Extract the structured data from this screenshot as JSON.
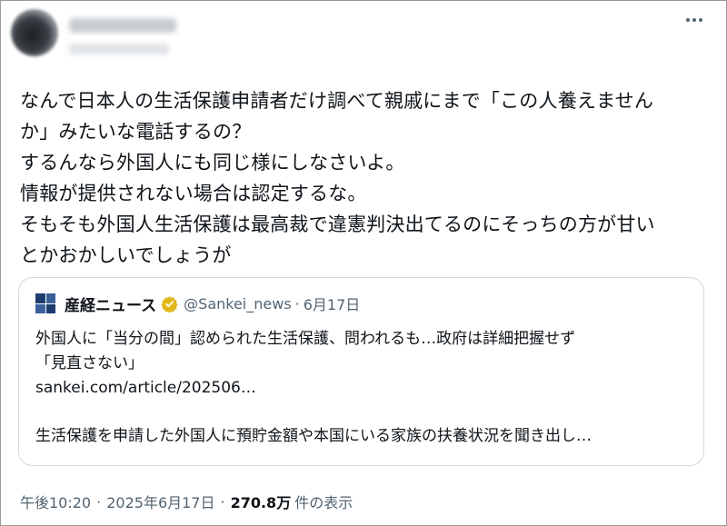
{
  "post": {
    "text_lines": [
      "なんで日本人の生活保護申請者だけ調べて親戚にまで「この人養えません",
      "か」みたいな電話するの？",
      "するんなら外国人にも同じ様にしなさいよ。",
      "情報が提供されない場合は認定するな。",
      "そもそも外国人生活保護は最高裁で違憲判決出てるのにそっちの方が甘い",
      "とかおかしいでしょうが"
    ]
  },
  "quote": {
    "name": "産経ニュース",
    "handle": "@Sankei_news",
    "dot": "·",
    "date": "6月17日",
    "lines": [
      "外国人に「当分の間」認められた生活保護、問われるも…政府は詳細把握せず",
      "「見直さない」",
      "sankei.com/article/202506…"
    ],
    "summary": "生活保護を申請した外国人に預貯金額や本国にいる家族の扶養状況を聞き出し…"
  },
  "meta": {
    "time": "午後10:20",
    "sep": "·",
    "date": "2025年6月17日",
    "views": "270.8万",
    "views_label": "件の表示"
  },
  "colors": {
    "text": "#0f1419",
    "secondary": "#536471",
    "border": "#cfd9de",
    "verified_gold": "#e2b719"
  },
  "icons": {
    "more": "more-dots-icon",
    "verified": "verified-badge-icon",
    "source_logo": "sankei-logo-icon"
  }
}
